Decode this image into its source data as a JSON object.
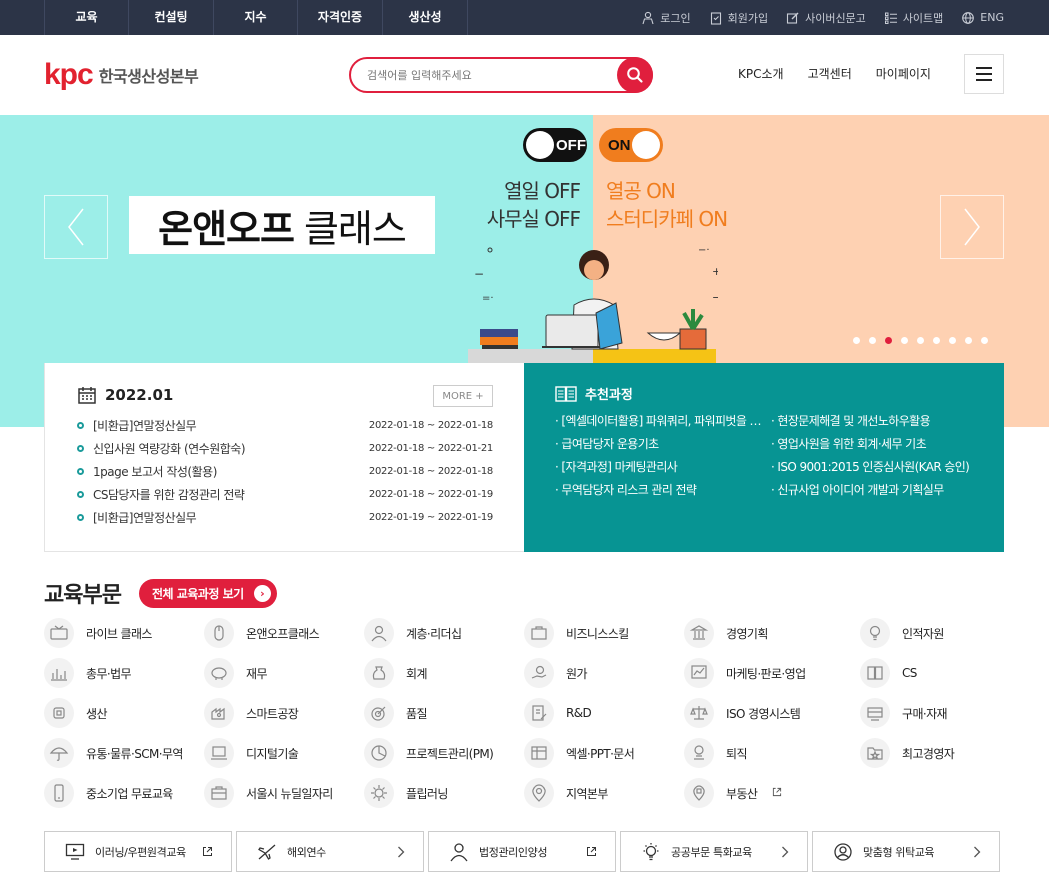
{
  "topnav": {
    "items": [
      "교육",
      "컨설팅",
      "지수",
      "자격인증",
      "생산성"
    ],
    "utils": [
      {
        "label": "로그인",
        "icon": "person-icon"
      },
      {
        "label": "회원가입",
        "icon": "clipboard-icon"
      },
      {
        "label": "사이버신문고",
        "icon": "edit-icon"
      },
      {
        "label": "사이트맵",
        "icon": "list-icon"
      },
      {
        "label": "ENG",
        "icon": "globe-icon"
      }
    ]
  },
  "header": {
    "logo_mark": "kpc",
    "logo_text": "한국생산성본부",
    "search_placeholder": "검색어를 입력해주세요",
    "gnb": [
      "KPC소개",
      "고객센터",
      "마이페이지"
    ]
  },
  "banner": {
    "title_bold": "온앤오프",
    "title_light": "클래스",
    "toggle_off": "OFF",
    "toggle_on": "ON",
    "slogan_left": [
      "열일 OFF",
      "사무실 OFF"
    ],
    "slogan_right": [
      "열공 ON",
      "스터디카페 ON"
    ],
    "slide_count": 9,
    "active_slide": 3,
    "colors": {
      "left": "#9ceee8",
      "right": "#fed1b2",
      "accent": "#f07d1e"
    }
  },
  "schedule": {
    "month": "2022.01",
    "more_label": "MORE +",
    "items": [
      {
        "title": "[비환급]연말정산실무",
        "date": "2022-01-18 ~ 2022-01-18"
      },
      {
        "title": "신입사원 역량강화 (연수원합숙)",
        "date": "2022-01-18 ~ 2022-01-21"
      },
      {
        "title": "1page 보고서 작성(활용)",
        "date": "2022-01-18 ~ 2022-01-18"
      },
      {
        "title": "CS담당자를 위한 감정관리 전략",
        "date": "2022-01-18 ~ 2022-01-19"
      },
      {
        "title": "[비환급]연말정산실무",
        "date": "2022-01-19 ~ 2022-01-19"
      }
    ]
  },
  "recommend": {
    "title": "추천과정",
    "items": [
      "· [엑셀데이터활용] 파워쿼리, 파워피벗을 활용한 데이터 분석",
      "· 현장문제해결 및 개선노하우활용",
      "· 급여담당자 운용기초",
      "· 영업사원을 위한 회계·세무 기초",
      "· [자격과정] 마케팅관리사",
      "· ISO 9001:2015 인증심사원(KAR 승인)",
      "· 무역담당자 리스크 관리 전략",
      "· 신규사업 아이디어 개발과 기획실무"
    ]
  },
  "education": {
    "title": "교육부문",
    "all_button": "전체 교육과정 보기",
    "categories": [
      {
        "label": "라이브 클래스",
        "icon": "live-icon"
      },
      {
        "label": "온앤오프클래스",
        "icon": "mouse-icon"
      },
      {
        "label": "계층·리더십",
        "icon": "person-icon"
      },
      {
        "label": "비즈니스스킬",
        "icon": "briefcase-icon"
      },
      {
        "label": "경영기획",
        "icon": "bank-icon"
      },
      {
        "label": "인적자원",
        "icon": "lightbulb-icon"
      },
      {
        "label": "총무·법무",
        "icon": "bar-chart-icon"
      },
      {
        "label": "재무",
        "icon": "piggy-bank-icon"
      },
      {
        "label": "회계",
        "icon": "money-bag-icon"
      },
      {
        "label": "원가",
        "icon": "coin-hand-icon"
      },
      {
        "label": "마케팅·판로·영업",
        "icon": "trend-chart-icon"
      },
      {
        "label": "CS",
        "icon": "book-icon"
      },
      {
        "label": "생산",
        "icon": "chip-icon"
      },
      {
        "label": "스마트공장",
        "icon": "factory-icon"
      },
      {
        "label": "품질",
        "icon": "target-icon"
      },
      {
        "label": "R&D",
        "icon": "document-edit-icon"
      },
      {
        "label": "ISO 경영시스템",
        "icon": "scale-icon"
      },
      {
        "label": "구매·자재",
        "icon": "cart-icon"
      },
      {
        "label": "유통·물류·SCM·무역",
        "icon": "umbrella-icon"
      },
      {
        "label": "디지털기술",
        "icon": "laptop-icon"
      },
      {
        "label": "프로젝트관리(PM)",
        "icon": "pie-chart-icon"
      },
      {
        "label": "엑셀·PPT·문서",
        "icon": "spreadsheet-icon"
      },
      {
        "label": "퇴직",
        "icon": "retire-icon"
      },
      {
        "label": "최고경영자",
        "icon": "star-folder-icon"
      },
      {
        "label": "중소기업 무료교육",
        "icon": "phone-icon"
      },
      {
        "label": "서울시 뉴딜일자리",
        "icon": "toolbox-icon"
      },
      {
        "label": "플립러닝",
        "icon": "virus-icon"
      },
      {
        "label": "지역본부",
        "icon": "map-pin-icon"
      },
      {
        "label": "부동산",
        "icon": "building-pin-icon"
      }
    ]
  },
  "bottom_links": [
    {
      "label": "이러닝/우편원격교육",
      "icon": "monitor-icon",
      "arrow": "external-link-icon"
    },
    {
      "label": "해외연수",
      "icon": "plane-icon",
      "arrow": "chevron-right-icon"
    },
    {
      "label": "법정관리인양성",
      "icon": "person-icon",
      "arrow": "external-link-icon"
    },
    {
      "label": "공공부문 특화교육",
      "icon": "lightbulb-icon",
      "arrow": "chevron-right-icon"
    },
    {
      "label": "맞춤형 위탁교육",
      "icon": "user-circle-icon",
      "arrow": "chevron-right-icon"
    }
  ]
}
